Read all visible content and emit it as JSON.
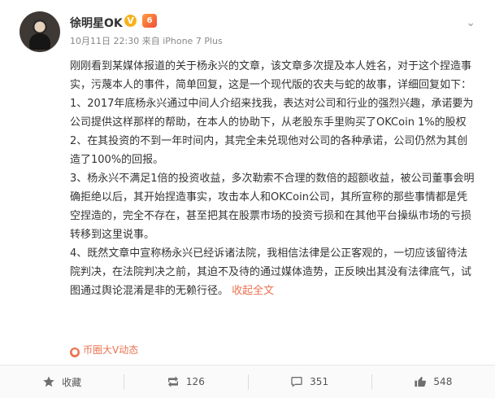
{
  "user": {
    "name": "徐明星OK",
    "vip_badge": "V",
    "medal": "6"
  },
  "meta": {
    "time": "10月11日 22:30",
    "source": "来自 iPhone 7 Plus"
  },
  "post": {
    "paragraphs": [
      "刚刚看到某媒体报道的关于杨永兴的文章，该文章多次提及本人姓名，对于这个捏造事实，污蔑本人的事件，简单回复，这是一个现代版的农夫与蛇的故事，详细回复如下：",
      "1、2017年底杨永兴通过中间人介绍来找我，表达对公司和行业的强烈兴趣，承诺要为公司提供这样那样的帮助，在本人的协助下，从老股东手里购买了OKCoin 1%的股权",
      "2、在其投资的不到一年时间内，其完全未兑现他对公司的各种承诺，公司仍然为其创造了100%的回报。",
      "3、杨永兴不满足1倍的投资收益，多次勒索不合理的数倍的超额收益，被公司董事会明确拒绝以后，其开始捏造事实，攻击本人和OKCoin公司，其所宣称的那些事情都是凭空捏造的，完全不存在，甚至把其在股票市场的投资亏损和在其他平台操纵市场的亏损转移到这里说事。",
      "4、既然文章中宣称杨永兴已经诉诸法院，我相信法律是公正客观的，一切应该留待法院判决，在法院判决之前，其迫不及待的通过媒体造势，正反映出其没有法律底气，试图通过舆论混淆是非的无赖行径。"
    ],
    "collapse_label": "收起全文",
    "tag": "币圈大V动态"
  },
  "actions": {
    "favorite": "收藏",
    "repost": "126",
    "comment": "351",
    "like": "548"
  }
}
